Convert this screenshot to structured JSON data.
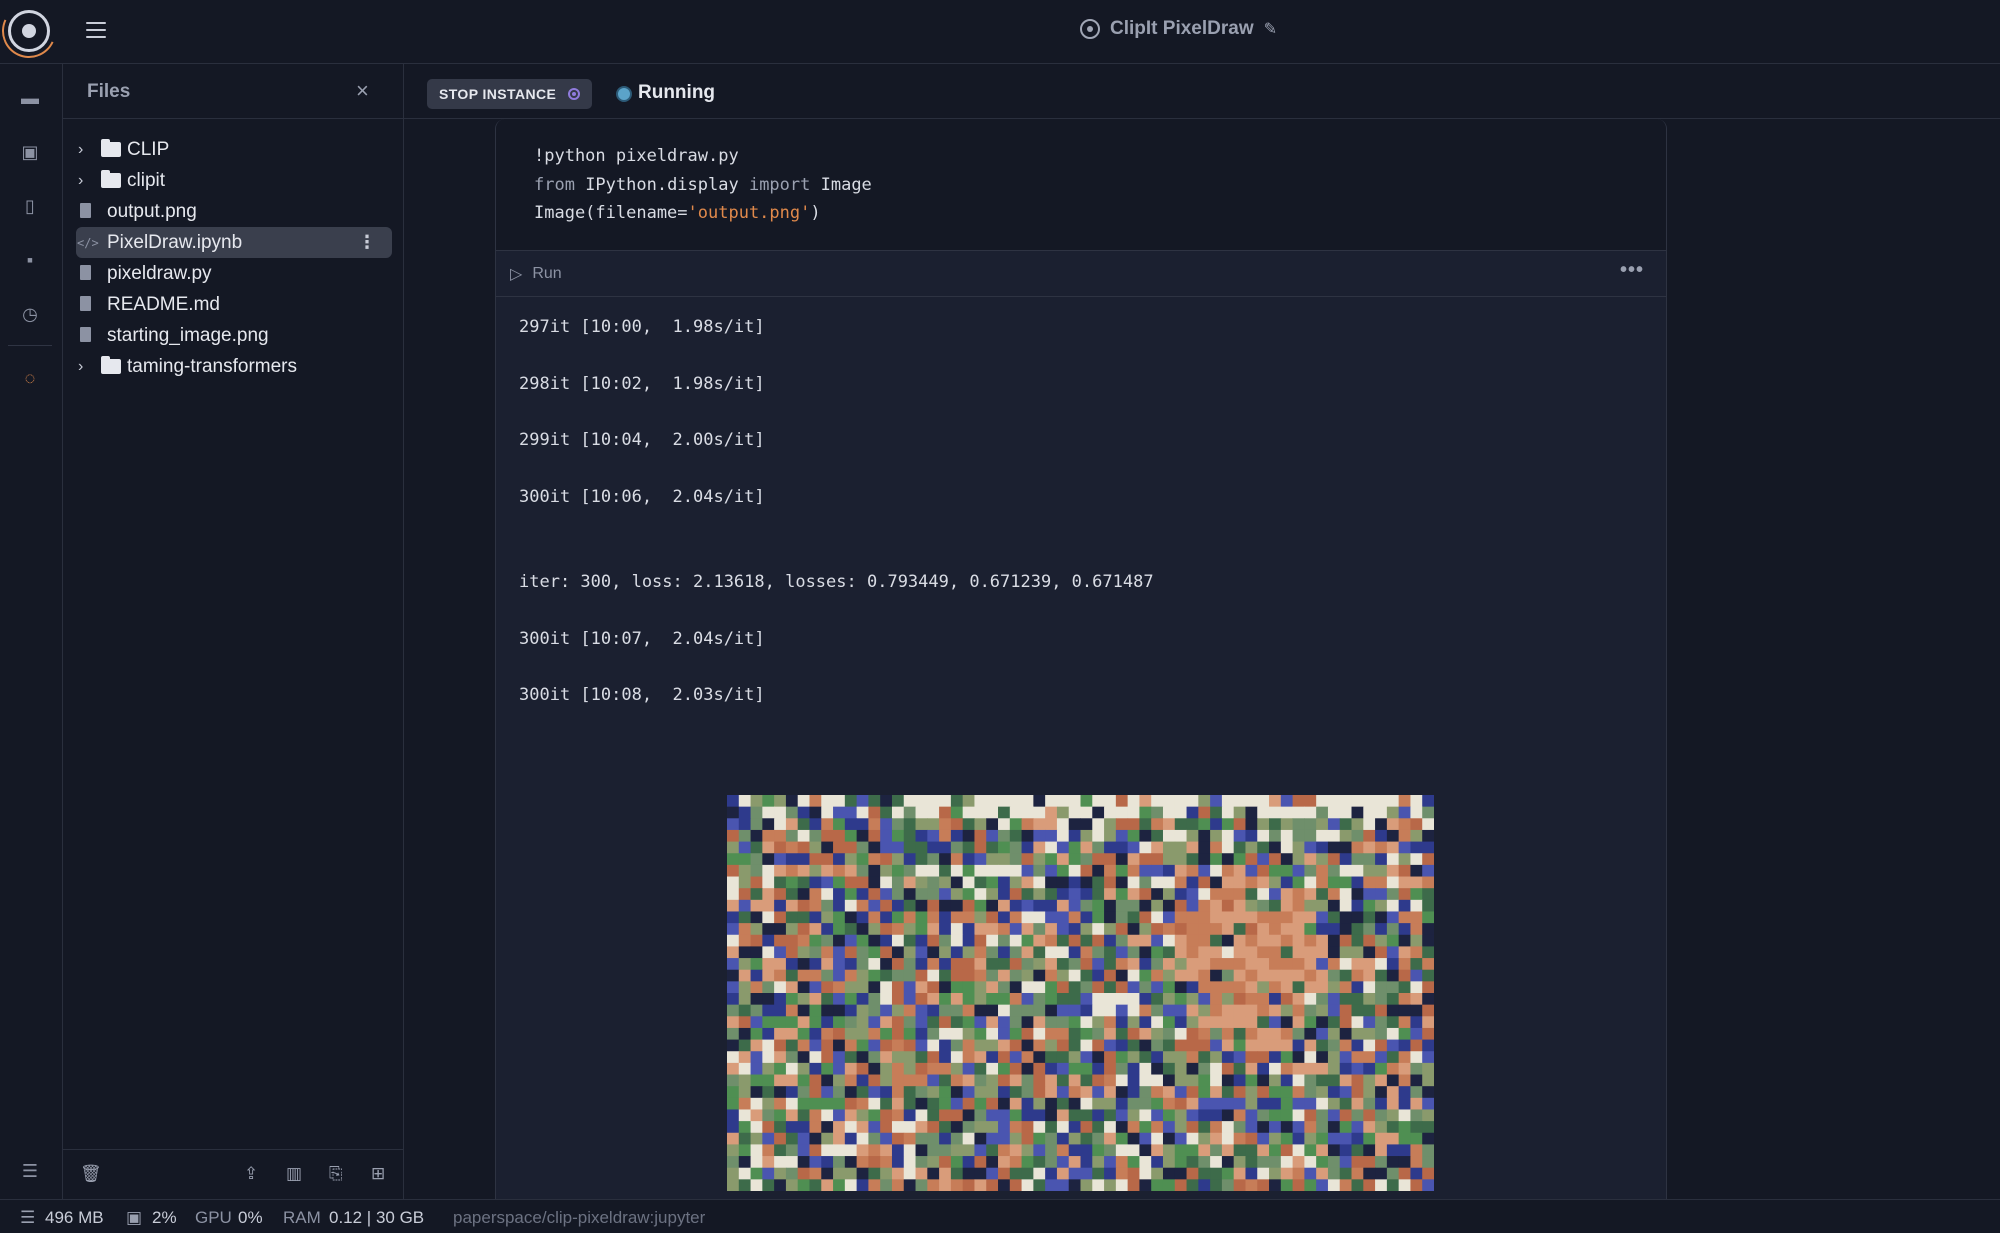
{
  "app": {
    "title": "ClipIt PixelDraw",
    "edit_icon": "edit-icon"
  },
  "sidebar_rail": {
    "icons": [
      "folder-icon",
      "cpu-icon",
      "file-search-icon",
      "terminal-icon",
      "clock-icon",
      "jupyter-icon",
      "database-icon"
    ]
  },
  "files_panel": {
    "title": "Files",
    "close": "×",
    "items": [
      {
        "type": "folder",
        "label": "CLIP"
      },
      {
        "type": "folder",
        "label": "clipit"
      },
      {
        "type": "file",
        "label": "output.png"
      },
      {
        "type": "notebook",
        "label": "PixelDraw.ipynb",
        "selected": true
      },
      {
        "type": "file",
        "label": "pixeldraw.py"
      },
      {
        "type": "file",
        "label": "README.md"
      },
      {
        "type": "file",
        "label": "starting_image.png"
      },
      {
        "type": "folder",
        "label": "taming-transformers"
      }
    ],
    "footer_icons": [
      "trash-icon",
      "upload-icon",
      "book-icon",
      "new-file-icon",
      "new-folder-icon"
    ]
  },
  "toolbar": {
    "stop_label": "STOP INSTANCE",
    "status": "Running",
    "status_color": "#5ba3c9"
  },
  "cell": {
    "code": [
      {
        "parts": [
          {
            "t": "!python pixeldraw.py",
            "c": ""
          }
        ]
      },
      {
        "parts": [
          {
            "t": "from",
            "c": "kw"
          },
          {
            "t": " IPython.display ",
            "c": ""
          },
          {
            "t": "import",
            "c": "kw"
          },
          {
            "t": " Image",
            "c": ""
          }
        ]
      },
      {
        "parts": [
          {
            "t": "Image(filename=",
            "c": ""
          },
          {
            "t": "'output.png'",
            "c": "str"
          },
          {
            "t": ")",
            "c": ""
          }
        ]
      }
    ],
    "run_label": "Run",
    "more": "•••",
    "output_lines": [
      "297it [10:00,  1.98s/it]",
      "298it [10:02,  1.98s/it]",
      "299it [10:04,  2.00s/it]",
      "300it [10:06,  2.04s/it]",
      "iter: 300, loss: 2.13618, losses: 0.793449, 0.671239, 0.671487",
      "300it [10:07,  2.04s/it]",
      "300it [10:08,  2.03s/it]"
    ]
  },
  "statusbar": {
    "disk": "496 MB",
    "cpu": "2%",
    "gpu_label": "GPU",
    "gpu": "0%",
    "ram_label": "RAM",
    "ram": "0.12 | 30 GB",
    "path": "paperspace/clip-pixeldraw:jupyter"
  },
  "colors": {
    "background": "#141824",
    "cell_bg": "#1b2030",
    "accent_orange": "#e0894b",
    "accent_purple": "#8f7bdc"
  }
}
